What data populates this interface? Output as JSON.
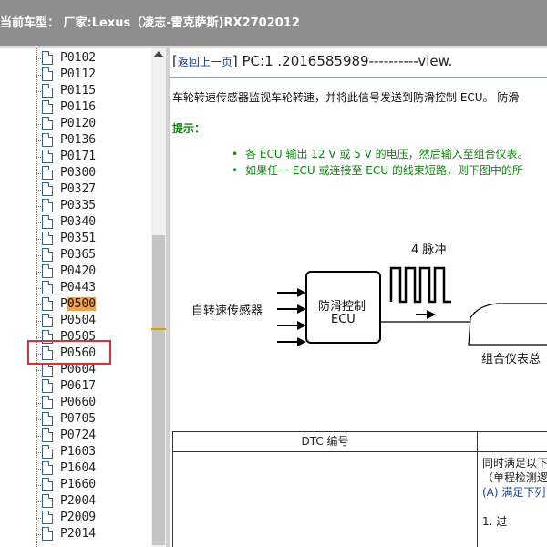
{
  "title": "当前车型： 厂家:Lexus（凌志-雷克萨斯)RX2702012",
  "tree": {
    "items": [
      "P0102",
      "P0112",
      "P0115",
      "P0116",
      "P0120",
      "P0136",
      "P0171",
      "P0300",
      "P0327",
      "P0335",
      "P0340",
      "P0351",
      "P0365",
      "P0420",
      "P0443",
      "P0500",
      "P0504",
      "P0505",
      "P0560",
      "P0604",
      "P0617",
      "P0660",
      "P0705",
      "P0724",
      "P1603",
      "P1604",
      "P1660",
      "P2004",
      "P2009",
      "P2014"
    ],
    "selected_prefix": "P",
    "selected_rest": "0500"
  },
  "content": {
    "back_link": "返回上一页",
    "pc_line": "PC:1 .2016585989----------view.",
    "description": "车轮转速传感器监视车轮转速，并将此信号发送到防滑控制 ECU。 防滑",
    "hint_label": "提示：",
    "bullets": [
      "各 ECU 输出 12 V 或 5 V 的电压，然后输入至组合仪表。",
      "如果任一 ECU 或连接至 ECU 的线束短路，则下图中的所"
    ],
    "diagram": {
      "pulse_label": "4 脉冲",
      "sensor_label": "自转速传感器",
      "ecu_label_1": "防滑控制",
      "ecu_label_2": "ECU",
      "meter_label": "组合仪表总"
    },
    "table": {
      "header_col1": "DTC 编号",
      "col2_lines": [
        "同时满足以下",
        "（单程检测逻",
        "(A) 满足下列",
        "",
        "    1. 过"
      ]
    }
  }
}
